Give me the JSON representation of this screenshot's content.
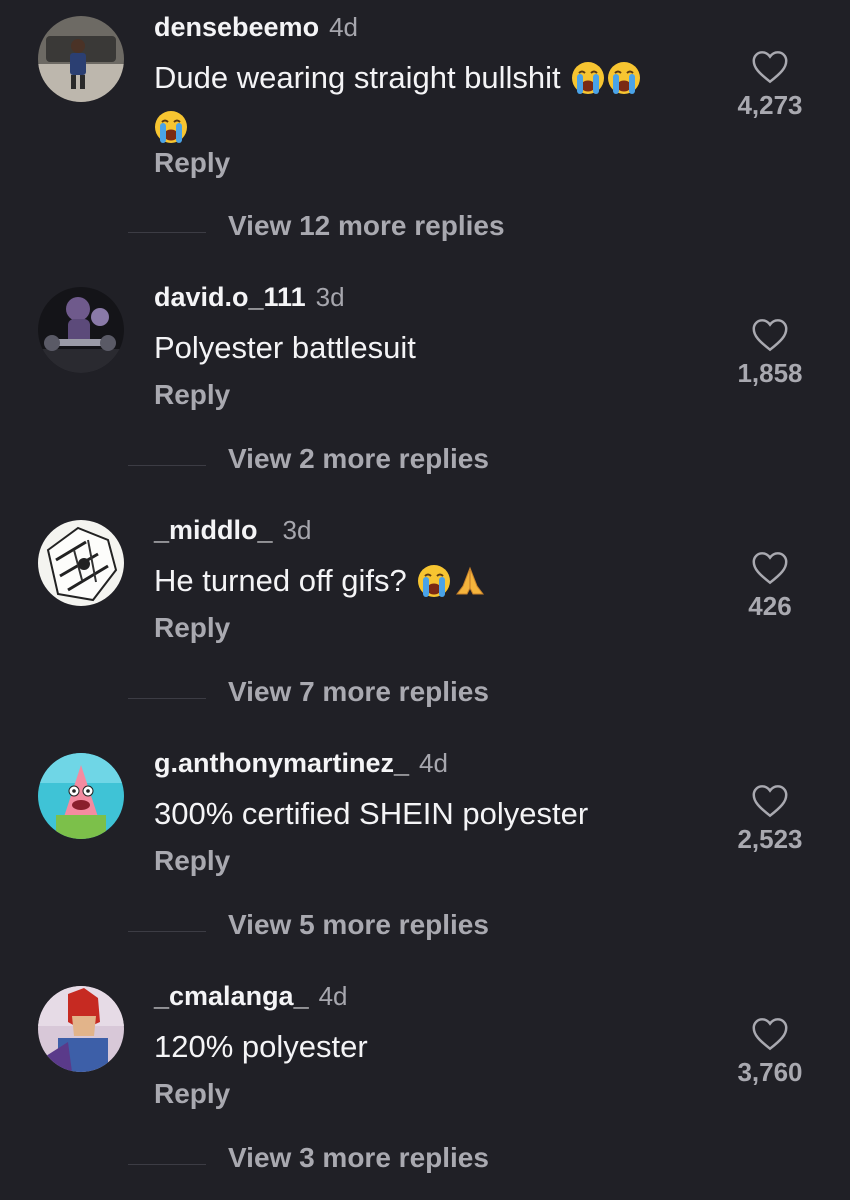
{
  "comments": [
    {
      "username": "densebeemo",
      "time": "4d",
      "text": "Dude wearing straight bullshit",
      "emojis": [
        "loudly-crying-face",
        "loudly-crying-face",
        "loudly-crying-face"
      ],
      "reply": "Reply",
      "likes": "4,273",
      "view_more": "View 12 more replies"
    },
    {
      "username": "david.o_111",
      "time": "3d",
      "text": "Polyester battlesuit",
      "emojis": [],
      "reply": "Reply",
      "likes": "1,858",
      "view_more": "View 2 more replies"
    },
    {
      "username": "_middlo_",
      "time": "3d",
      "text": "He turned off gifs?",
      "emojis": [
        "loudly-crying-face",
        "folded-hands"
      ],
      "reply": "Reply",
      "likes": "426",
      "view_more": "View 7 more replies"
    },
    {
      "username": "g.anthonymartinez_",
      "time": "4d",
      "text": "300% certified SHEIN polyester",
      "emojis": [],
      "reply": "Reply",
      "likes": "2,523",
      "view_more": "View 5 more replies"
    },
    {
      "username": "_cmalanga_",
      "time": "4d",
      "text": "120% polyester",
      "emojis": [],
      "reply": "Reply",
      "likes": "3,760",
      "view_more": "View 3 more replies"
    }
  ],
  "colors": {
    "background": "#202026",
    "primary_text": "#f4f4f6",
    "secondary_text": "#a9a9b0"
  },
  "icons": [
    "heart-outline-icon",
    "loudly-crying-face-emoji",
    "folded-hands-emoji"
  ]
}
